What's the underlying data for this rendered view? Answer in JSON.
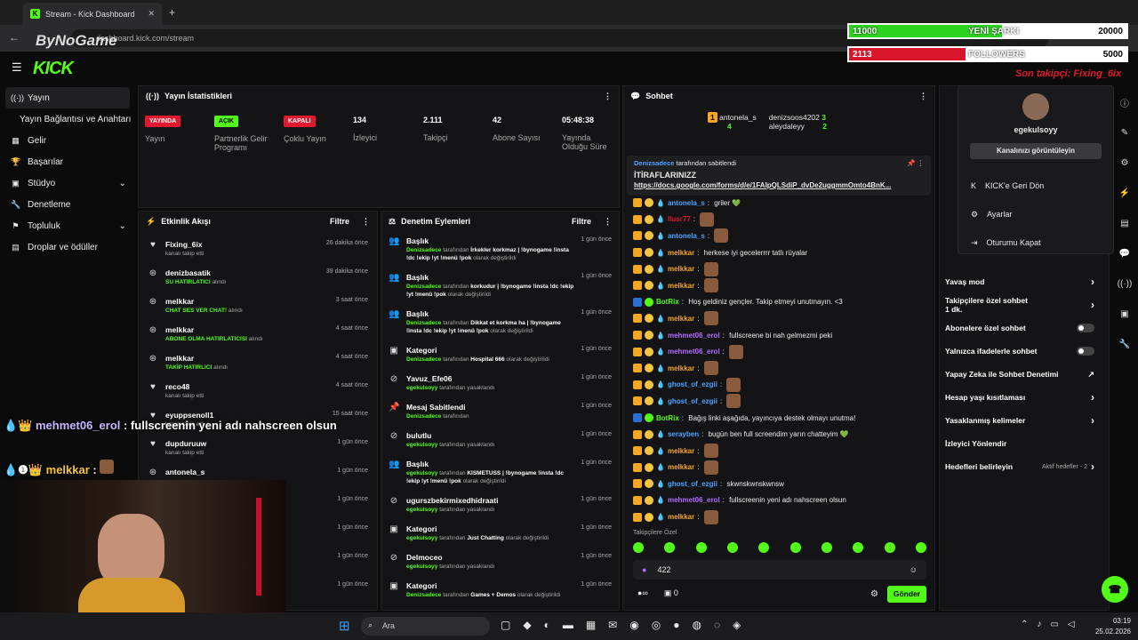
{
  "browser": {
    "tab_title": "Stream - Kick Dashboard",
    "url": "dashboard.kick.com/stream",
    "watermark": "ByNoGame"
  },
  "brand": {
    "logo": "KICK",
    "colors": {
      "accent": "#53fc18",
      "red": "#e1192e"
    }
  },
  "sidebar": {
    "items": [
      {
        "label": "Yayın",
        "icon": "broadcast-icon"
      },
      {
        "label": "Yayın Bağlantısı ve Anahtarı"
      },
      {
        "label": "Gelir",
        "icon": "grid-icon"
      },
      {
        "label": "Başarılar",
        "icon": "trophy-icon"
      },
      {
        "label": "Stüdyo",
        "icon": "studio-icon"
      },
      {
        "label": "Denetleme",
        "icon": "wrench-icon"
      },
      {
        "label": "Topluluk",
        "icon": "community-icon"
      },
      {
        "label": "Droplar ve ödüller",
        "icon": "drop-icon"
      }
    ]
  },
  "stats": {
    "title": "Yayın İstatistikleri",
    "items": [
      {
        "badge": "YAYINDA",
        "label": "Yayın"
      },
      {
        "badge": "AÇIK",
        "label": "Partnerlik Gelir Programı"
      },
      {
        "badge": "KAPALI",
        "label": "Çoklu Yayın"
      },
      {
        "value": "134",
        "label": "İzleyici"
      },
      {
        "value": "2.111",
        "label": "Takipçi"
      },
      {
        "value": "42",
        "label": "Abone Sayısı"
      },
      {
        "value": "05:48:38",
        "label": "Yayında Olduğu Süre"
      }
    ]
  },
  "activity": {
    "title": "Etkinlik Akışı",
    "filter": "Filtre",
    "rows": [
      {
        "name": "Fixing_6ix",
        "sub": "kanalı takip etti",
        "time": "26 dakika önce"
      },
      {
        "name": "denizbasatik",
        "hl": "SU HATIRLATICI",
        "sub": " alındı",
        "time": "39 dakika önce"
      },
      {
        "name": "melkkar",
        "hl": "CHAT SES VER CHAT!",
        "sub": " alındı",
        "time": "3 saat önce"
      },
      {
        "name": "melkkar",
        "hl": "ABONE OLMA HATIRLATICISI",
        "sub": " alındı",
        "time": "4 saat önce"
      },
      {
        "name": "melkkar",
        "hl": "TAKİP HATIRLICI",
        "sub": " alındı",
        "time": "4 saat önce"
      },
      {
        "name": "reco48",
        "sub": "kanalı takip etti",
        "time": "4 saat önce"
      },
      {
        "name": "eyuppsenoll1",
        "sub": "kanalı takip etti",
        "time": "15 saat önce"
      },
      {
        "name": "dupduruuw",
        "sub": "kanalı takip etti",
        "time": "1 gün önce"
      },
      {
        "name": "antonela_s",
        "sub": "",
        "time": "1 gün önce"
      },
      {
        "name": "",
        "sub": "",
        "time": "1 gün önce"
      },
      {
        "name": "",
        "sub": "",
        "time": "1 gün önce"
      },
      {
        "name": "",
        "sub": "",
        "time": "1 gün önce"
      },
      {
        "name": "",
        "sub": "",
        "time": "1 gün önce"
      }
    ]
  },
  "modlog": {
    "title": "Denetim Eylemleri",
    "filter": "Filtre",
    "rows": [
      {
        "title": "Başlık",
        "actor": "Denizsadece",
        "mid": " tarafından ",
        "detail": "İrkekler korkmaz | !bynogame !insta !dc !ekip !yt !menü !pok",
        "tail": " olarak değiştirildi",
        "time": "1 gün önce"
      },
      {
        "title": "Başlık",
        "actor": "Denizsadece",
        "mid": " tarafından ",
        "detail": "korkudur | !bynogame !insta !dc !ekip !yt !menü !pok",
        "tail": " olarak değiştirildi",
        "time": "1 gün önce"
      },
      {
        "title": "Başlık",
        "actor": "Denizsadece",
        "mid": " tarafından ",
        "detail": "Dikkat et korkma ha | !bynogame !insta !dc !ekip !yt !menü !pok",
        "tail": " olarak değiştirildi",
        "time": "1 gün önce"
      },
      {
        "title": "Kategori",
        "actor": "Denizsadece",
        "mid": " tarafından ",
        "detail": "Hospital 666",
        "tail": " olarak değiştirildi",
        "time": "1 gün önce"
      },
      {
        "title": "Yavuz_Efe06",
        "actor": "egekulsoyy",
        "mid": " tarafından yasaklandı",
        "detail": "",
        "tail": "",
        "time": "1 gün önce"
      },
      {
        "title": "Mesaj Sabitlendi",
        "actor": "Denizsadece",
        "mid": " tarafından",
        "detail": "",
        "tail": "",
        "time": "1 gün önce"
      },
      {
        "title": "bulutlu",
        "actor": "egekulsoyy",
        "mid": " tarafından yasaklandı",
        "detail": "",
        "tail": "",
        "time": "1 gün önce"
      },
      {
        "title": "Başlık",
        "actor": "egekulsoyy",
        "mid": " tarafından ",
        "detail": "KISMETUSS | !bynogame !insta !dc !ekip !yt !menü !pok",
        "tail": " olarak değiştirildi",
        "time": "1 gün önce"
      },
      {
        "title": "ugurszbekirmixedhidraati",
        "actor": "egekulsoyy",
        "mid": " tarafından yasaklandı",
        "detail": "",
        "tail": "",
        "time": "1 gün önce"
      },
      {
        "title": "Kategori",
        "actor": "egekulsoyy",
        "mid": " tarafından ",
        "detail": "Just Chatting",
        "tail": " olarak değiştirildi",
        "time": "1 gün önce"
      },
      {
        "title": "Delmoceo",
        "actor": "egekulsoyy",
        "mid": " tarafından yasaklandı",
        "detail": "",
        "tail": "",
        "time": "1 gün önce"
      },
      {
        "title": "Kategori",
        "actor": "Denizsadece",
        "mid": " tarafından ",
        "detail": "Games + Demos",
        "tail": " olarak değiştirildi",
        "time": "1 gün önce"
      }
    ]
  },
  "chat": {
    "title": "Sohbet",
    "top": [
      {
        "name": "antonela_s",
        "count": "4",
        "rank": "1"
      },
      {
        "name": "denizsoos4202",
        "count": "3"
      },
      {
        "name": "aleydaleyy",
        "count": "2"
      }
    ],
    "pinned": {
      "by": "Denizsadece",
      "by_suffix": " tarafından sabitlendi",
      "title": "İTİRAFLARINIZZ",
      "link": "https://docs.google.com/forms/d/e/1FAIpQLSdiP_dvDe2uggmmOmto4BnK..."
    },
    "messages": [
      {
        "user": "antonela_s",
        "color": "#4da3ff",
        "text": "griler 💚"
      },
      {
        "user": "llusr77",
        "color": "#e1192e",
        "text": ""
      },
      {
        "user": "antonela_s",
        "color": "#4da3ff",
        "text": ""
      },
      {
        "user": "melkkar",
        "color": "#f5a623",
        "text": "herkese iyi gecelerrrr tatlı rüyalar"
      },
      {
        "user": "melkkar",
        "color": "#f5a623",
        "text": ""
      },
      {
        "user": "melkkar",
        "color": "#f5a623",
        "text": ""
      },
      {
        "user": "BotRix",
        "color": "#53fc18",
        "text": "Hoş geldiniz gençler. Takip etmeyi unutmayın. <3"
      },
      {
        "user": "melkkar",
        "color": "#f5a623",
        "text": ""
      },
      {
        "user": "mehmet06_erol",
        "color": "#b46cff",
        "text": "fullscreene bi nah gelmezmi peki"
      },
      {
        "user": "mehmet06_erol",
        "color": "#b46cff",
        "text": ""
      },
      {
        "user": "melkkar",
        "color": "#f5a623",
        "text": ""
      },
      {
        "user": "ghost_of_ezgii",
        "color": "#4da3ff",
        "text": ""
      },
      {
        "user": "ghost_of_ezgii",
        "color": "#4da3ff",
        "text": ""
      },
      {
        "user": "BotRix",
        "color": "#53fc18",
        "text": "Bağış linki aşağıda, yayıncıya destek olmayı unutma!"
      },
      {
        "user": "serayben",
        "color": "#4da3ff",
        "text": "bugün ben full screendim yarın chatteyim 💚"
      },
      {
        "user": "melkkar",
        "color": "#f5a623",
        "text": ""
      },
      {
        "user": "melkkar",
        "color": "#f5a623",
        "text": ""
      },
      {
        "user": "ghost_of_ezgii",
        "color": "#4da3ff",
        "text": "skwnskwnskwnsw"
      },
      {
        "user": "mehmet06_erol",
        "color": "#b46cff",
        "text": "fullscreenin yeni adı nahscreen olsun"
      },
      {
        "user": "melkkar",
        "color": "#f5a623",
        "text": ""
      }
    ],
    "emote_label": "Takipçilere Özel",
    "input_value": "422",
    "points": "∞",
    "gifts": "0",
    "send": "Gönder"
  },
  "settings": {
    "rows": [
      {
        "label": "Yavaş mod",
        "kind": "chevron"
      },
      {
        "label": "Takipçilere özel sohbet",
        "sub": "1 dk.",
        "kind": "chevron"
      },
      {
        "label": "Abonelere özel sohbet",
        "kind": "toggle"
      },
      {
        "label": "Yalnızca ifadelerle sohbet",
        "kind": "toggle"
      },
      {
        "label": "Yapay Zeka ile Sohbet Denetimi",
        "kind": "ext"
      },
      {
        "label": "Hesap yaşı kısıtlaması",
        "kind": "chevron"
      },
      {
        "label": "Yasaklanmış kelimeler",
        "kind": "chevron"
      },
      {
        "label": "İzleyici Yönlendir",
        "kind": ""
      },
      {
        "label": "Hedefleri belirleyin",
        "extra": "Aktif hedefler - 2",
        "kind": "chevron"
      }
    ]
  },
  "user_menu": {
    "username": "egekulsoyy",
    "view": "Kanalınızı görüntüleyin",
    "items": [
      "KICK'e Geri Dön",
      "Ayarlar",
      "Oturumu Kapat"
    ]
  },
  "overlay": {
    "bar1_left": "11000",
    "bar1_mid": "YENİ ŞARKI",
    "bar1_right": "20000",
    "bar1_progress": 0.55,
    "bar2_left": "2113",
    "bar2_mid": "FOLLOWERS",
    "bar2_right": "5000",
    "bar2_progress": 0.42,
    "last_follower": "Son takipçi: Fixing_6ix",
    "chat1_user": "mehmet06_erol",
    "chat1_text": "fullscreenin yeni adı nahscreen olsun",
    "chat2_user": "melkkar"
  },
  "taskbar": {
    "search": "Ara",
    "time": "03:19",
    "date": "25.02.2026"
  }
}
